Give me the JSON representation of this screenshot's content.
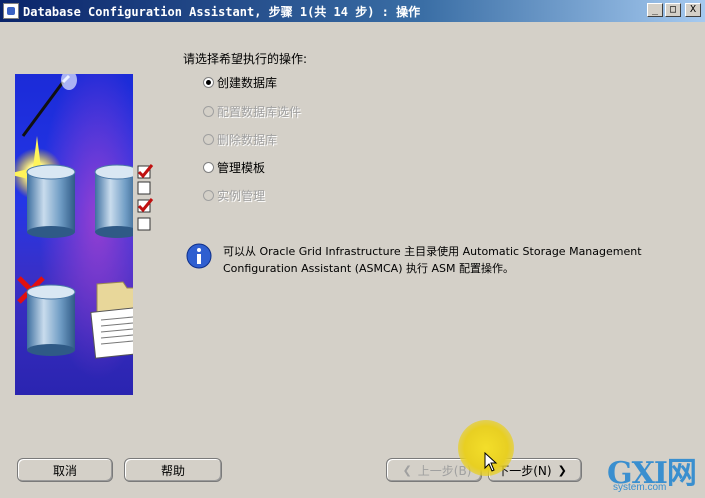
{
  "window": {
    "title": "Database Configuration Assistant, 步骤 1(共 14 步) : 操作",
    "minimize": "_",
    "maximize": "□",
    "close": "X"
  },
  "prompt": "请选择希望执行的操作:",
  "options": [
    {
      "label": "创建数据库",
      "checked": true,
      "enabled": true
    },
    {
      "label": "配置数据库选件",
      "checked": false,
      "enabled": false
    },
    {
      "label": "删除数据库",
      "checked": false,
      "enabled": false
    },
    {
      "label": "管理模板",
      "checked": false,
      "enabled": true
    },
    {
      "label": "实例管理",
      "checked": false,
      "enabled": false
    }
  ],
  "info": {
    "icon": "info-icon",
    "text": "可以从 Oracle Grid Infrastructure 主目录使用 Automatic Storage Management Configuration Assistant (ASMCA) 执行 ASM 配置操作。"
  },
  "buttons": {
    "cancel": "取消",
    "help": "帮助",
    "back": "上一步(B)",
    "next": "下一步(N)"
  },
  "watermark": {
    "main": "GXI网",
    "sub": "system.com"
  },
  "colors": {
    "dialog_bg": "#d4d0c8",
    "title_bar": "#0a246a",
    "art_bg": "#2436e6",
    "info_icon": "#2f5fd0",
    "disabled_text": "#a0a0a0"
  }
}
